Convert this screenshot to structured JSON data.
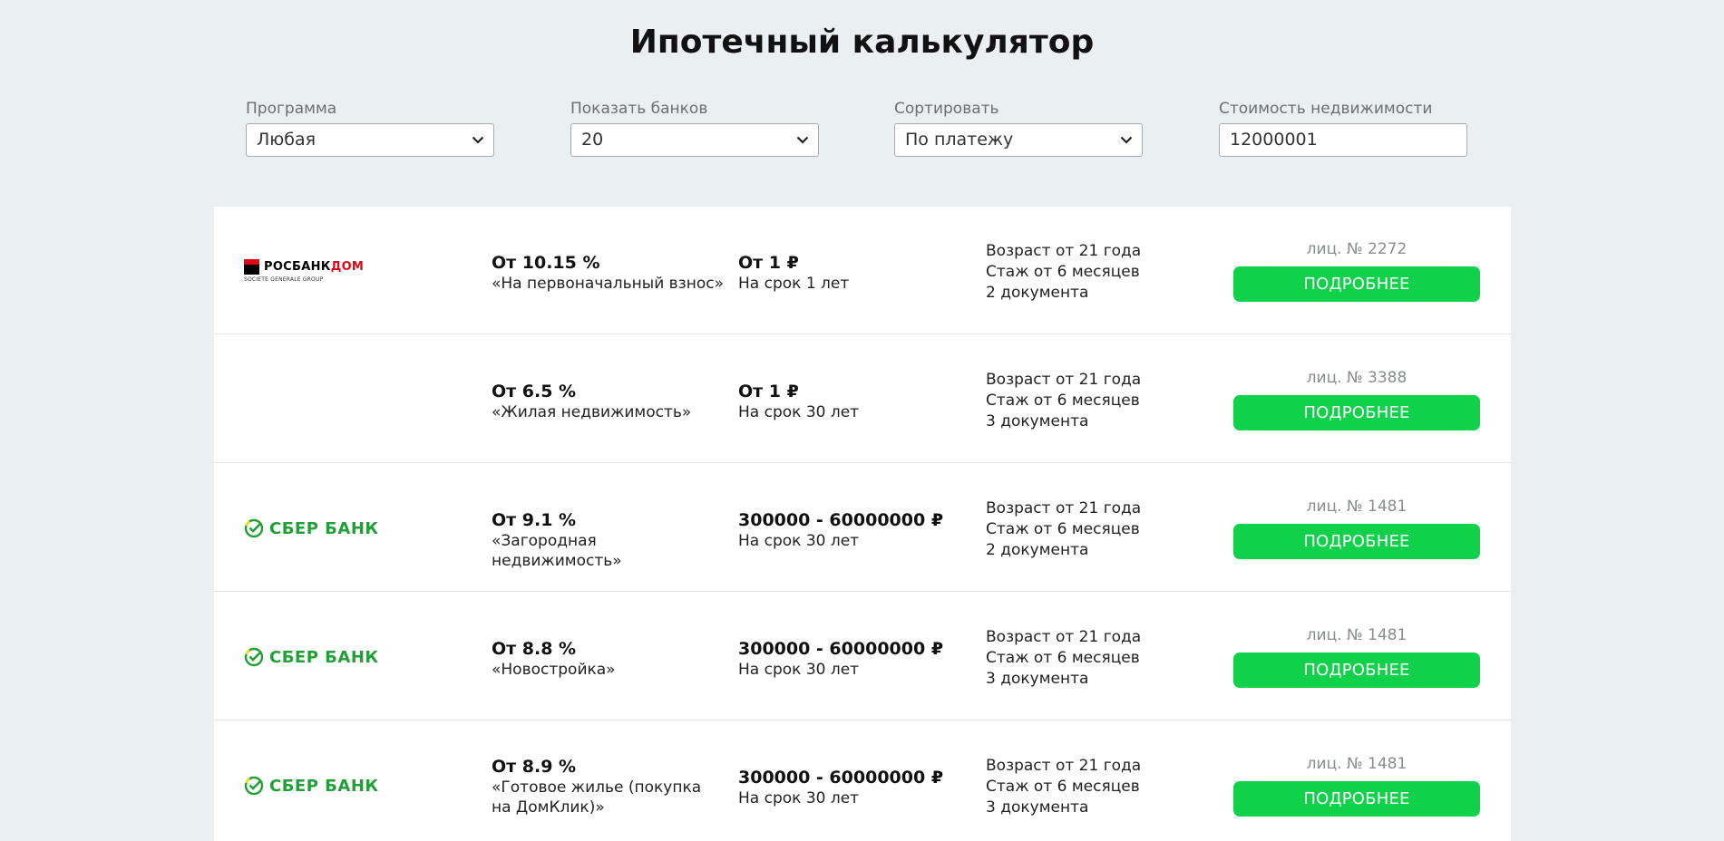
{
  "page_title": "Ипотечный калькулятор",
  "filters": {
    "program": {
      "label": "Программа",
      "value": "Любая"
    },
    "banks": {
      "label": "Показать банков",
      "value": "20"
    },
    "sort": {
      "label": "Сортировать",
      "value": "По платежу"
    },
    "price": {
      "label": "Стоимость недвижимости",
      "value": "12000001"
    }
  },
  "colors": {
    "accent_green": "#10d24a",
    "sber_green": "#21a038",
    "rosbank_red": "#e30613",
    "background": "#eaeff2"
  },
  "offers": [
    {
      "bank_logo": "rosbank-dom-logo",
      "logo_text_1": "РОСБАНК",
      "logo_text_2": "ДОМ",
      "logo_sub": "SOCIETE GENERALE GROUP",
      "rate": "От 10.15 %",
      "program": "«На первоначальный взнос»",
      "sum": "От 1 ₽",
      "term": "На срок 1 лет",
      "age": "Возраст от 21 года",
      "experience": "Стаж от 6 месяцев",
      "docs": "2 документа",
      "license": "лиц. № 2272",
      "button": "ПОДРОБНЕЕ"
    },
    {
      "bank_logo": "none",
      "rate": "От 6.5 %",
      "program": "«Жилая недвижимость»",
      "sum": "От 1 ₽",
      "term": "На срок 30 лет",
      "age": "Возраст от 21 года",
      "experience": "Стаж от 6 месяцев",
      "docs": "3 документа",
      "license": "лиц. № 3388",
      "button": "ПОДРОБНЕЕ"
    },
    {
      "bank_logo": "sberbank-logo",
      "logo_text": "СБЕР БАНК",
      "rate": "От 9.1 %",
      "program": "«Загородная недвижимость»",
      "sum": "300000 - 60000000 ₽",
      "term": "На срок 30 лет",
      "age": "Возраст от 21 года",
      "experience": "Стаж от 6 месяцев",
      "docs": "2 документа",
      "license": "лиц. № 1481",
      "button": "ПОДРОБНЕЕ"
    },
    {
      "bank_logo": "sberbank-logo",
      "logo_text": "СБЕР БАНК",
      "rate": "От 8.8 %",
      "program": "«Новостройка»",
      "sum": "300000 - 60000000 ₽",
      "term": "На срок 30 лет",
      "age": "Возраст от 21 года",
      "experience": "Стаж от 6 месяцев",
      "docs": "3 документа",
      "license": "лиц. № 1481",
      "button": "ПОДРОБНЕЕ"
    },
    {
      "bank_logo": "sberbank-logo",
      "logo_text": "СБЕР БАНК",
      "rate": "От 8.9 %",
      "program": "«Готовое жилье (покупка на ДомКлик)»",
      "sum": "300000 - 60000000 ₽",
      "term": "На срок 30 лет",
      "age": "Возраст от 21 года",
      "experience": "Стаж от 6 месяцев",
      "docs": "3 документа",
      "license": "лиц. № 1481",
      "button": "ПОДРОБНЕЕ"
    }
  ]
}
